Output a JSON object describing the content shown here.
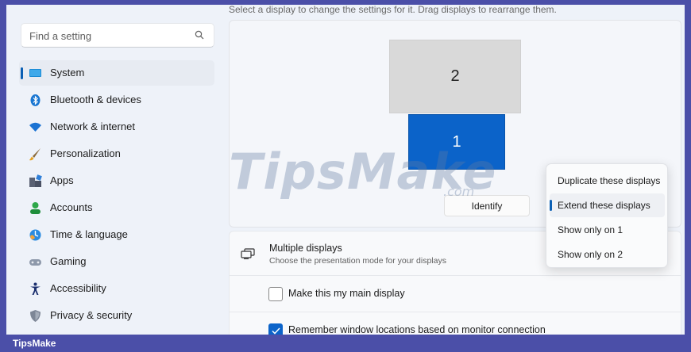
{
  "search": {
    "placeholder": "Find a setting",
    "icon": "search-icon"
  },
  "sidebar": {
    "items": [
      {
        "label": "System",
        "icon": "system-icon",
        "active": true
      },
      {
        "label": "Bluetooth & devices",
        "icon": "bluetooth-icon"
      },
      {
        "label": "Network & internet",
        "icon": "wifi-icon"
      },
      {
        "label": "Personalization",
        "icon": "brush-icon"
      },
      {
        "label": "Apps",
        "icon": "apps-icon"
      },
      {
        "label": "Accounts",
        "icon": "accounts-icon"
      },
      {
        "label": "Time & language",
        "icon": "clock-globe-icon"
      },
      {
        "label": "Gaming",
        "icon": "gamepad-icon"
      },
      {
        "label": "Accessibility",
        "icon": "accessibility-icon"
      },
      {
        "label": "Privacy & security",
        "icon": "shield-icon"
      }
    ]
  },
  "main": {
    "subtitle": "Select a display to change the settings for it. Drag displays to rearrange them.",
    "monitors": {
      "primary": "1",
      "secondary": "2"
    },
    "identify_label": "Identify",
    "multiple_displays": {
      "title": "Multiple displays",
      "description": "Choose the presentation mode for your displays"
    },
    "main_display_label": "Make this my main display",
    "remember_label": "Remember window locations based on monitor connection"
  },
  "dropdown": {
    "options": [
      "Duplicate these displays",
      "Extend these displays",
      "Show only on 1",
      "Show only on 2"
    ],
    "selected": "Extend these displays"
  },
  "watermark": {
    "text": "TipsMake",
    "suffix": ".com"
  },
  "footer": {
    "brand": "TipsMake"
  },
  "colors": {
    "accent": "#0b63c9",
    "frame": "#4b4fa8"
  }
}
